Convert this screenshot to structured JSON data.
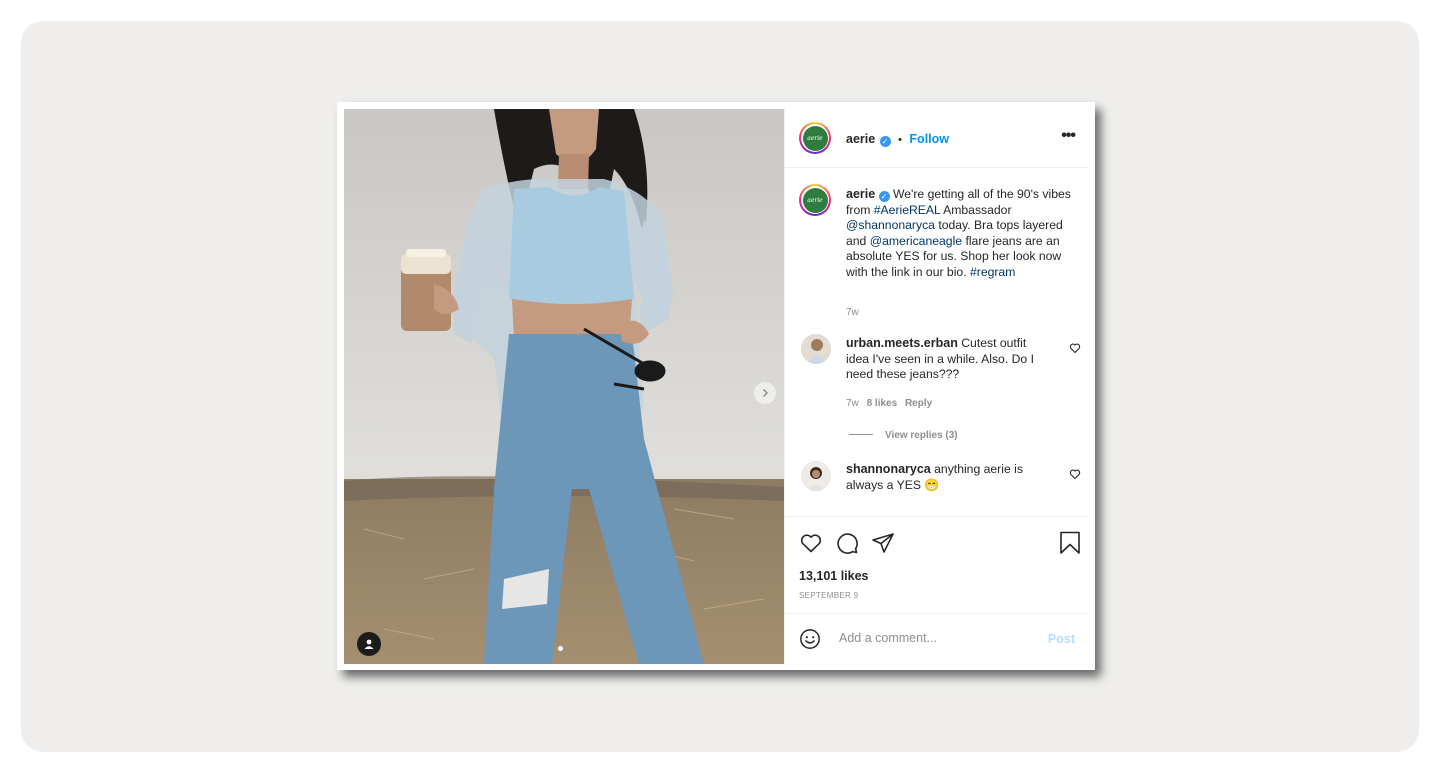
{
  "post": {
    "account": "aerie",
    "avatar_text": "aerie",
    "follow_label": "Follow",
    "separator": "•",
    "more_label": "•••",
    "caption": {
      "username": "aerie",
      "parts": [
        {
          "text": "We're getting all of the 90's vibes from "
        },
        {
          "text": "#AerieREAL",
          "link": true
        },
        {
          "text": " Ambassador "
        },
        {
          "text": "@shannonaryca",
          "link": true
        },
        {
          "text": " today. Bra tops layered and "
        },
        {
          "text": "@americaneagle",
          "link": true
        },
        {
          "text": " flare jeans are an absolute YES for us. Shop her look now with the link in our bio. "
        },
        {
          "text": "#regram",
          "link": true
        }
      ],
      "time": "7w"
    },
    "comments": [
      {
        "username": "urban.meets.erban",
        "text": "Cutest outfit idea I've seen in a while. Also. Do I need these jeans???",
        "time": "7w",
        "likes": "8 likes",
        "reply_label": "Reply",
        "view_replies": "View replies (3)"
      },
      {
        "username": "shannonaryca",
        "text": "anything aerie is always a YES",
        "emoji": "😁"
      }
    ],
    "likes": "13,101 likes",
    "date": "SEPTEMBER 9",
    "comment_placeholder": "Add a comment...",
    "post_label": "Post"
  },
  "icons": {
    "like": "heart-icon",
    "comment": "comment-icon",
    "share": "paper-plane-icon",
    "save": "bookmark-icon",
    "emoji": "smiley-icon",
    "next": "chevron-right-icon",
    "tagged": "user-icon"
  },
  "colors": {
    "link": "#00376b",
    "follow": "#0095f6",
    "verified": "#3897f0",
    "brand_green": "#2e7d3e",
    "post_disabled": "#b2dffc"
  }
}
